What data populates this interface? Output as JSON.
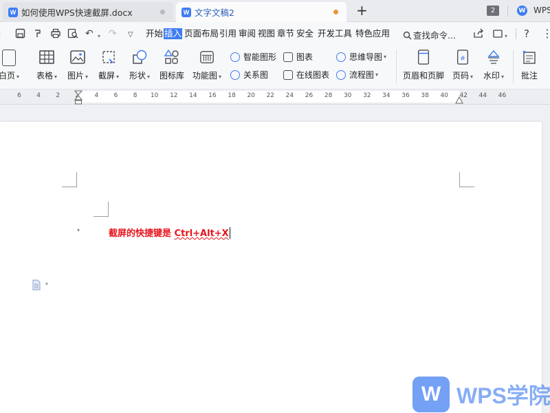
{
  "tabs": [
    {
      "title": "如何使用WPS快速截屏.docx",
      "icon": "wps-writer-icon"
    },
    {
      "title": "文字文稿2",
      "icon": "wps-writer-icon",
      "active": true
    }
  ],
  "window_count": "2",
  "brand": "WPS",
  "menu": {
    "items": [
      "开始",
      "插入",
      "页面布局",
      "引用",
      "审阅",
      "视图",
      "章节",
      "安全",
      "开发工具",
      "特色应用"
    ],
    "active": "插入",
    "search_label": "查找命令..."
  },
  "ribbon": {
    "blank_page": "白页",
    "table": "表格",
    "picture": "图片",
    "screenshot": "截屏",
    "shape": "形状",
    "icon_lib": "图标库",
    "func_chart": "功能图",
    "smart_shape": "智能图形",
    "chart": "图表",
    "mind_map": "思维导图",
    "relation": "关系图",
    "online_chart": "在线图表",
    "flowchart": "流程图",
    "header_footer": "页眉和页脚",
    "page_number": "页码",
    "watermark": "水印",
    "comment": "批注"
  },
  "ruler_ticks": [
    "6",
    "4",
    "2",
    "2",
    "4",
    "6",
    "8",
    "10",
    "12",
    "14",
    "16",
    "18",
    "20",
    "22",
    "24",
    "26",
    "28",
    "30",
    "32",
    "34",
    "36",
    "38",
    "40",
    "42",
    "44",
    "46"
  ],
  "document": {
    "prefix": "截屏的快捷键是 ",
    "shortcut": "Ctrl+Alt+X"
  },
  "colors": {
    "accent": "#3f7cf2",
    "doc_text": "#e8141c",
    "modified_dot": "#f0923a"
  },
  "watermark": {
    "text": "WPS学院"
  }
}
